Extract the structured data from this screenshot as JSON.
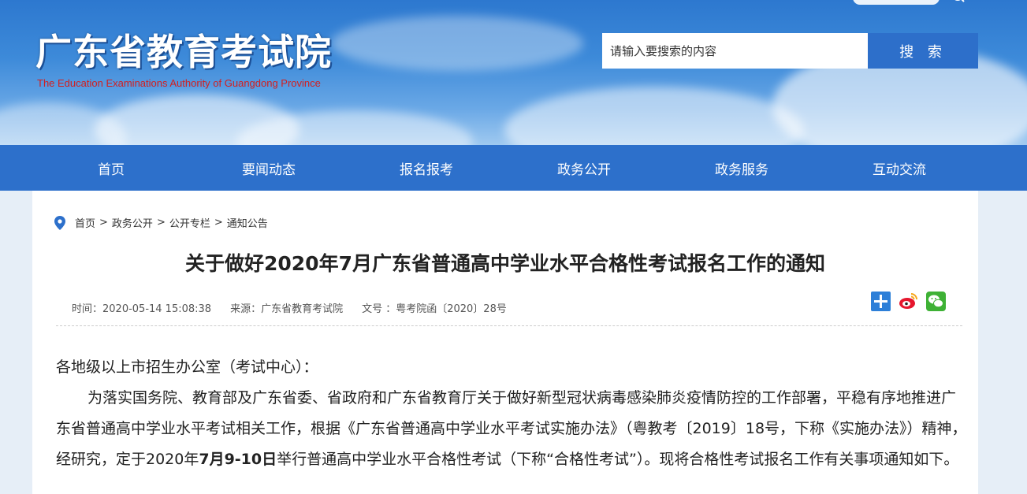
{
  "header": {
    "logo_cn": "广东省教育考试院",
    "logo_en": "The Education Examinations Authority of Guangdong Province",
    "search_placeholder": "请输入要搜索的内容",
    "search_button": "搜 索"
  },
  "nav": {
    "items": [
      "首页",
      "要闻动态",
      "报名报考",
      "政务公开",
      "政务服务",
      "互动交流"
    ]
  },
  "breadcrumb": {
    "items": [
      "首页",
      "政务公开",
      "公开专栏",
      "通知公告"
    ],
    "separator": ">"
  },
  "article": {
    "title": "关于做好2020年7月广东省普通高中学业水平合格性考试报名工作的通知",
    "time": "时间：2020-05-14 15:08:38",
    "source": "来源：广东省教育考试院",
    "doc_no": "文号 ：粤考院函〔2020〕28号",
    "salutation": "各地级以上市招生办公室（考试中心）：",
    "para_part1": "为落实国务院、教育部及广东省委、省政府和广东省教育厅关于做好新型冠状病毒感染肺炎疫情防控的工作部署，平稳有序地推进广东省普通高中学业水平考试相关工作，根据《广东省普通高中学业水平考试实施办法》（粤教考〔2019〕18号，下称《实施办法》）精神，经研究，定于2020年",
    "para_bold": "7月9-10日",
    "para_part2": "举行普通高中学业水平合格性考试（下称“合格性考试”）。现将合格性考试报名工作有关事项通知如下。"
  },
  "colors": {
    "nav_blue": "#2d70cb",
    "search_button_blue": "#2d6fca",
    "logo_en_red": "#d21f1f"
  },
  "icons": [
    "location-pin-icon",
    "share-plus-icon",
    "weibo-icon",
    "wechat-icon",
    "search-icon"
  ]
}
